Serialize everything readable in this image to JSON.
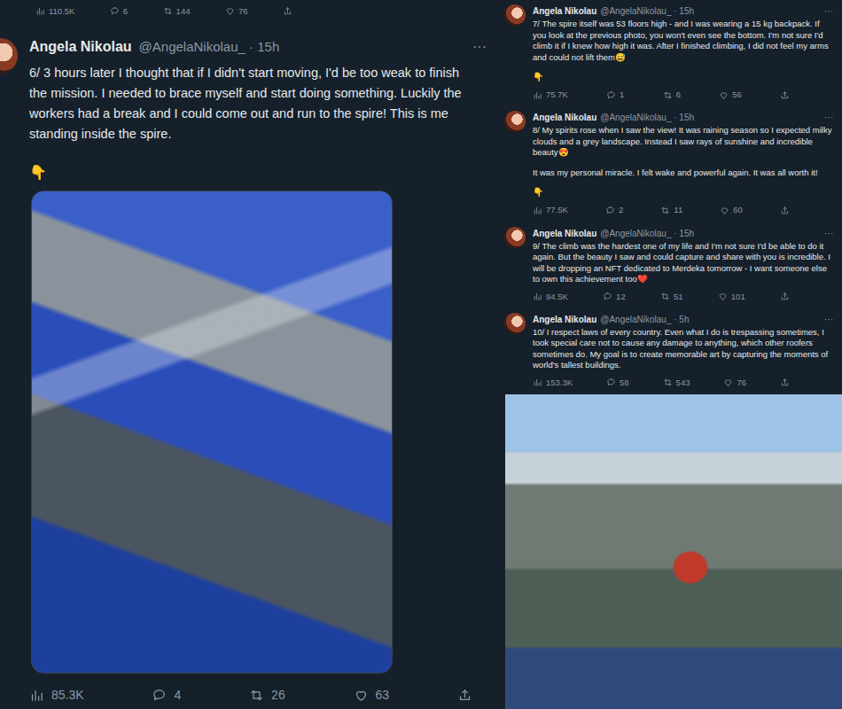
{
  "top_partial_stats": {
    "views": "110.5K",
    "replies": "6",
    "retweets": "144",
    "likes": "76"
  },
  "main_tweet": {
    "author": "Angela Nikolau",
    "meta": "@AngelaNikolau_ · 15h",
    "menu": "···",
    "paragraphs": [
      "6/ 3 hours later I thought that if I didn't start moving, I'd be too weak to finish the mission. I needed to brace myself and start doing something. Luckily the workers had a break and I could come out and run to the spire! This is me standing inside the spire."
    ],
    "pointer": "👇",
    "stats": {
      "views": "85.3K",
      "replies": "4",
      "retweets": "26",
      "likes": "63"
    }
  },
  "thread": [
    {
      "author": "Angela Nikolau",
      "meta": "@AngelaNikolau_ · 15h",
      "menu": "···",
      "paragraphs": [
        "7/ The spire itself was 53 floors high - and I was wearing a 15 kg backpack. If you look at the previous photo, you won't even see the bottom. I'm not sure I'd climb it if I knew how high it was. After I finished climbing, I did not feel my arms and could not lift them😅"
      ],
      "pointer": "👇",
      "stats": {
        "views": "75.7K",
        "replies": "1",
        "retweets": "6",
        "likes": "56"
      }
    },
    {
      "author": "Angela Nikolau",
      "meta": "@AngelaNikolau_ · 15h",
      "menu": "···",
      "paragraphs": [
        "8/ My spirits rose when I saw the view! It was raining season so I expected milky clouds and a grey landscape. Instead I saw rays of sunshine and incredible beauty😍",
        "It was my personal miracle. I felt wake and powerful again. It was all worth it!"
      ],
      "pointer": "👇",
      "stats": {
        "views": "77.5K",
        "replies": "2",
        "retweets": "11",
        "likes": "60"
      }
    },
    {
      "author": "Angela Nikolau",
      "meta": "@AngelaNikolau_ · 15h",
      "menu": "···",
      "paragraphs": [
        "9/ The climb was the hardest one of my life and I'm not sure I'd be able to do it again. But the beauty I saw and could capture and share with you is incredible. I will be dropping an NFT dedicated to Merdeka tomorrow - I want someone else to own this achievement too❤️"
      ],
      "stats": {
        "views": "94.5K",
        "replies": "12",
        "retweets": "51",
        "likes": "101"
      }
    },
    {
      "author": "Angela Nikolau",
      "meta": "@AngelaNikolau_ · 5h",
      "menu": "···",
      "paragraphs": [
        "10/ I respect laws of every country. Even what I do is trespassing sometimes, I took special care not to cause any damage to anything, which other roofers sometimes do. My goal is to create memorable art by capturing the moments of world's tallest buildings."
      ],
      "stats": {
        "views": "153.3K",
        "replies": "58",
        "retweets": "543",
        "likes": "76"
      }
    }
  ]
}
